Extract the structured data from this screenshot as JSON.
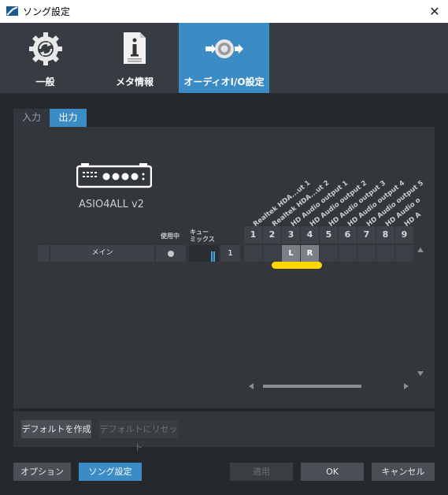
{
  "window": {
    "title": "ソング設定",
    "close_glyph": "✕"
  },
  "top_tabs": [
    {
      "label": "一般",
      "icon": "gear-sync-icon"
    },
    {
      "label": "メタ情報",
      "icon": "document-info-icon"
    },
    {
      "label": "オーディオI/O設定",
      "icon": "speaker-io-icon",
      "active": true
    }
  ],
  "sub_tabs": {
    "input": "入力",
    "output": "出力"
  },
  "device": {
    "name": "ASIO4ALL v2"
  },
  "columns": {
    "in_use": "使用中",
    "cue_mix_line1": "キュー",
    "cue_mix_line2": "ミックス"
  },
  "channel_labels": [
    "Realtek HDA...ut 1",
    "Realtek HDA...ut 2",
    "HD Audio output 1",
    "HD Audio output 2",
    "HD Audio output 3",
    "HD Audio output 4",
    "HD Audio output 5",
    "HD Audio o",
    "HD A"
  ],
  "channel_numbers": [
    "1",
    "2",
    "3",
    "4",
    "5",
    "6",
    "7",
    "8",
    "9"
  ],
  "output_row": {
    "name": "メイン",
    "number": "1",
    "assignments": {
      "3": "L",
      "4": "R"
    }
  },
  "lower_buttons": {
    "create_default": "デフォルトを作成",
    "reset_default": "デフォルトにリセット"
  },
  "footer_buttons": {
    "options": "オプション",
    "song_settings": "ソング設定",
    "apply": "適用",
    "ok": "OK",
    "cancel": "キャンセル"
  },
  "colors": {
    "accent": "#3b8bc4",
    "highlight": "#ffd700",
    "background": "#25282c",
    "panel": "#33363b"
  }
}
